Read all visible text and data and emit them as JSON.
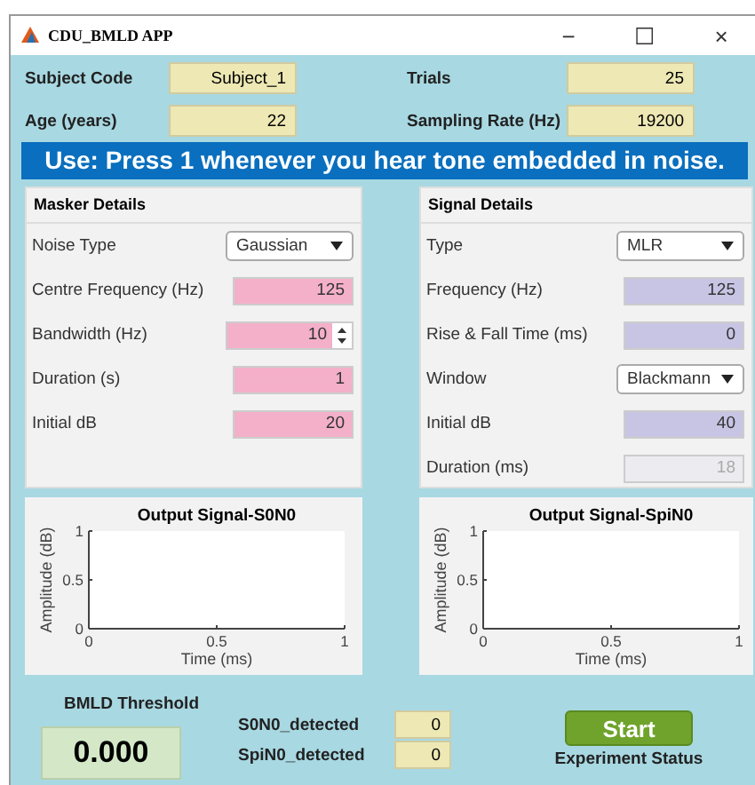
{
  "window": {
    "title": "CDU_BMLD APP",
    "controls": [
      "−",
      "☐",
      "×"
    ]
  },
  "top_fields": [
    {
      "label": "Subject Code",
      "value": "Subject_1"
    },
    {
      "label": "Trials",
      "value": "25"
    },
    {
      "label": "Age (years)",
      "value": "22"
    },
    {
      "label": "Sampling Rate (Hz)",
      "value": "19200"
    }
  ],
  "banner": "Use: Press 1 whenever you hear tone embedded in noise.",
  "panels": [
    {
      "title": "Masker Details",
      "fields": [
        {
          "label": "Noise Type",
          "kind": "dropdown",
          "value": "Gaussian",
          "disabled": false
        },
        {
          "label": "Centre Frequency (Hz)",
          "kind": "text",
          "value": "125",
          "disabled": false
        },
        {
          "label": "Bandwidth (Hz)",
          "kind": "spinner",
          "value": "10",
          "disabled": false
        },
        {
          "label": "Duration (s)",
          "kind": "text",
          "value": "1",
          "disabled": false
        },
        {
          "label": "Initial dB",
          "kind": "text",
          "value": "20",
          "disabled": false
        }
      ]
    },
    {
      "title": "Signal Details",
      "fields": [
        {
          "label": "Type",
          "kind": "dropdown",
          "value": "MLR",
          "disabled": false
        },
        {
          "label": "Frequency (Hz)",
          "kind": "text",
          "value": "125",
          "disabled": false
        },
        {
          "label": "Rise & Fall Time (ms)",
          "kind": "text",
          "value": "0",
          "disabled": false
        },
        {
          "label": "Window",
          "kind": "dropdown",
          "value": "Blackmann",
          "disabled": false
        },
        {
          "label": "Initial dB",
          "kind": "text",
          "value": "40",
          "disabled": false
        },
        {
          "label": "Duration (ms)",
          "kind": "text",
          "value": "18",
          "disabled": true
        }
      ]
    }
  ],
  "charts": [
    {
      "chart_data": {
        "type": "line",
        "title": "Output Signal-S0N0",
        "xlabel": "Time (ms)",
        "ylabel": "Amplitude (dB)",
        "xlim": [
          0,
          1
        ],
        "ylim": [
          0,
          1
        ],
        "xticks": [
          0,
          0.5,
          1
        ],
        "yticks": [
          0,
          0.5,
          1
        ]
      }
    },
    {
      "chart_data": {
        "type": "line",
        "title": "Output Signal-SpiN0",
        "xlabel": "Time (ms)",
        "ylabel": "Amplitude (dB)",
        "xlim": [
          0,
          1
        ],
        "ylim": [
          0,
          1
        ],
        "xticks": [
          0,
          0.5,
          1
        ],
        "yticks": [
          0,
          0.5,
          1
        ]
      }
    }
  ],
  "threshold": {
    "label": "BMLD Threshold",
    "value": "0.000"
  },
  "counters": [
    {
      "label": "S0N0_detected",
      "value": "0"
    },
    {
      "label": "SpiN0_detected",
      "value": "0"
    }
  ],
  "start_button": "Start",
  "status_label": "Experiment Status"
}
